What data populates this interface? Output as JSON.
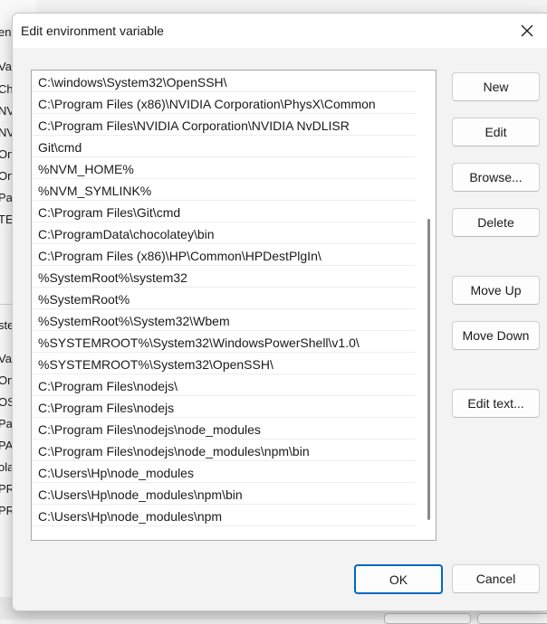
{
  "background_window": {
    "fragments": [
      "en",
      "Va",
      "Ch",
      "NV",
      "NV",
      "On",
      "On",
      "Pa",
      "TE",
      "ste",
      "Va",
      "On",
      "OS",
      "Pa",
      "PA",
      "ola",
      "PR",
      "PR"
    ]
  },
  "dialog": {
    "title": "Edit environment variable",
    "close_icon": "close-icon"
  },
  "path_list": {
    "items": [
      "C:\\windows\\System32\\OpenSSH\\",
      "C:\\Program Files (x86)\\NVIDIA Corporation\\PhysX\\Common",
      "C:\\Program Files\\NVIDIA Corporation\\NVIDIA NvDLISR",
      "Git\\cmd",
      "%NVM_HOME%",
      "%NVM_SYMLINK%",
      "C:\\Program Files\\Git\\cmd",
      "C:\\ProgramData\\chocolatey\\bin",
      "C:\\Program Files (x86)\\HP\\Common\\HPDestPlgIn\\",
      "%SystemRoot%\\system32",
      "%SystemRoot%",
      "%SystemRoot%\\System32\\Wbem",
      "%SYSTEMROOT%\\System32\\WindowsPowerShell\\v1.0\\",
      "%SYSTEMROOT%\\System32\\OpenSSH\\",
      "C:\\Program Files\\nodejs\\",
      "C:\\Program Files\\nodejs",
      "C:\\Program Files\\nodejs\\node_modules",
      "C:\\Program Files\\nodejs\\node_modules\\npm\\bin",
      "C:\\Users\\Hp\\node_modules",
      "C:\\Users\\Hp\\node_modules\\npm\\bin",
      "C:\\Users\\Hp\\node_modules\\npm"
    ]
  },
  "buttons": {
    "new": "New",
    "edit": "Edit",
    "browse": "Browse...",
    "delete": "Delete",
    "move_up": "Move Up",
    "move_down": "Move Down",
    "edit_text": "Edit text...",
    "ok": "OK",
    "cancel": "Cancel"
  },
  "colors": {
    "accent": "#0067c0",
    "dialog_bg": "#f3f3f3",
    "titlebar_bg": "#ffffff"
  }
}
